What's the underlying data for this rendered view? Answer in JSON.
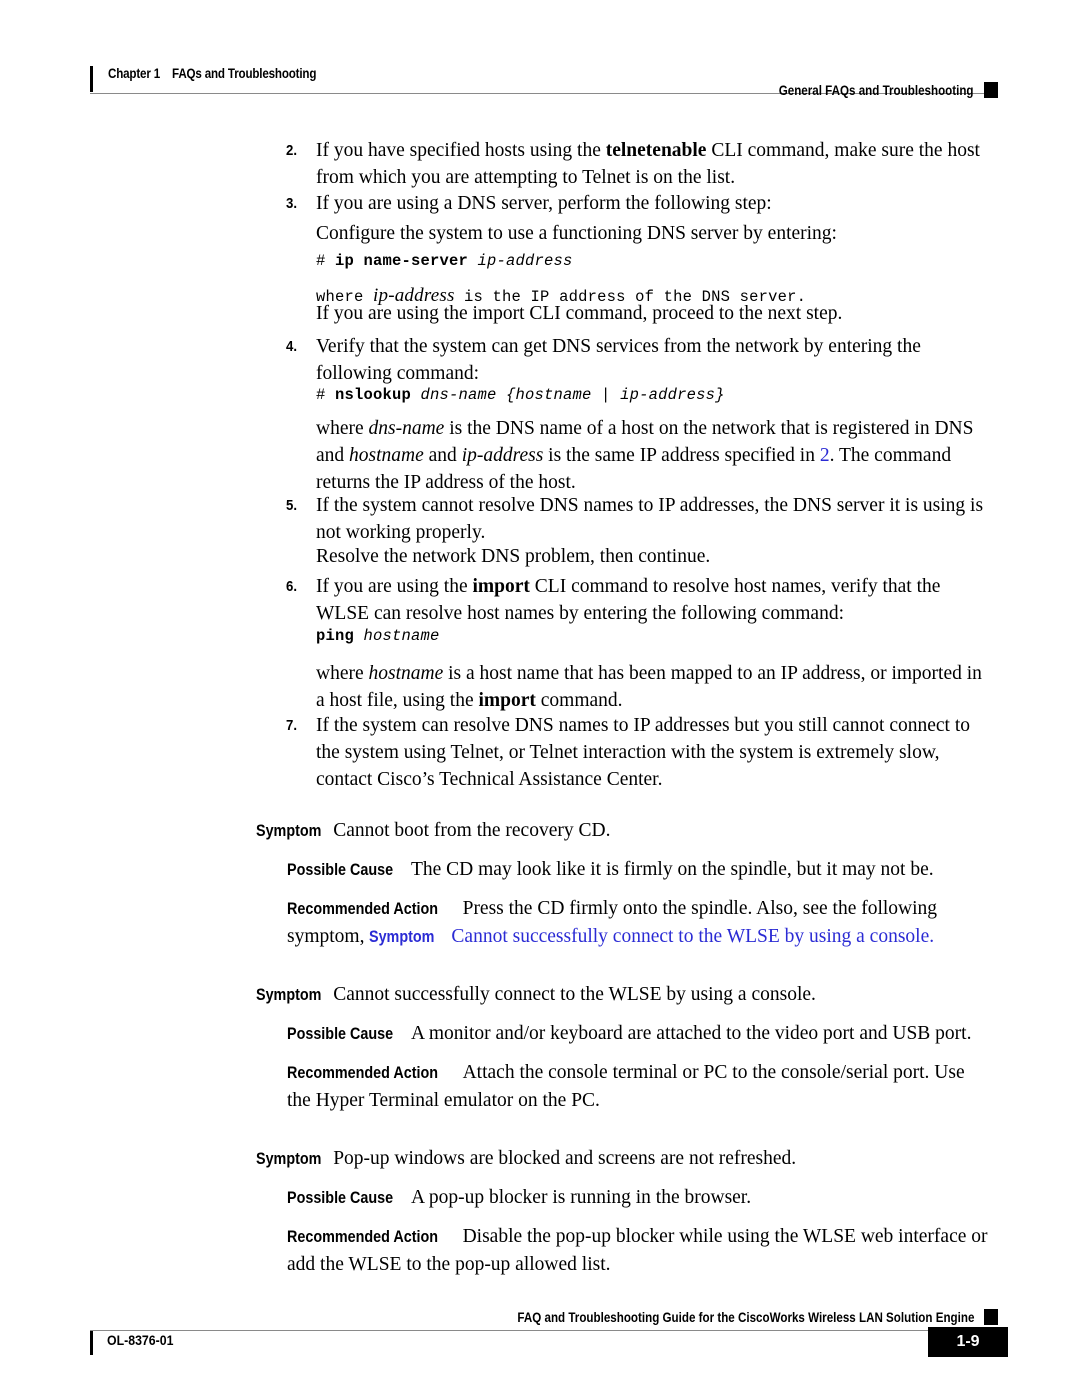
{
  "header": {
    "chapter_number": "Chapter 1",
    "chapter_title": "FAQs and Troubleshooting",
    "running_head": "General FAQs and Troubleshooting"
  },
  "steps": [
    {
      "number": "2.",
      "text_pre": "If you have specified hosts using the ",
      "bold": "telnetenable",
      "text_post": " CLI command, make sure the host from which you are attempting to Telnet is on the list."
    },
    {
      "number": "3.",
      "text": "If you are using a DNS server, perform the following step:"
    },
    {
      "number": "4.",
      "text": "Verify that the system can get DNS services from the network by entering the following command:"
    },
    {
      "number": "5.",
      "text": "If the system cannot resolve DNS names to IP addresses, the DNS server it is using is not working properly."
    },
    {
      "number": "6.",
      "text_pre": "If you are using the ",
      "bold": "import",
      "text_post": " CLI command to resolve host names, verify that the WLSE can resolve host names by entering the following command:"
    },
    {
      "number": "7.",
      "text": "If the system can resolve DNS names to IP addresses but you still cannot connect to the system using Telnet, or Telnet interaction with the system is extremely slow, contact Cisco’s Technical Assistance Center."
    }
  ],
  "paragraphs": {
    "configure_dns": "Configure the system to use a functioning DNS server by entering:",
    "import_next_step": "If you are using the import CLI command, proceed to the next step.",
    "resolve_continue": "Resolve the network DNS problem, then continue."
  },
  "code_blocks": {
    "ip_name_server": {
      "prompt": "# ",
      "command": "ip name-server",
      "arg": " ip-address"
    },
    "nslookup": {
      "prompt": "# ",
      "command": "nslookup",
      "arg": " dns-name {hostname | ip-address}"
    },
    "ping": {
      "prompt": "",
      "command": "ping",
      "arg": " hostname"
    }
  },
  "mono_note": {
    "where": "where ",
    "term": "ip-address",
    "rest": " is the IP address of the DNS server."
  },
  "where_clauses": {
    "dns_name": {
      "pre": "where ",
      "term1": "dns-name",
      "mid1": " is the DNS name of a host on the network that is registered in DNS and ",
      "term2": "hostname",
      "mid2": " and ",
      "term3": "ip-address",
      "mid3": " is the same IP address specified in ",
      "link": "2",
      "post": ". The command returns the IP address of the host."
    },
    "hostname": {
      "pre": "where ",
      "term": "hostname",
      "mid": " is a host name that has been mapped to an IP address, or imported in a host file, using the ",
      "bold": "import",
      "post": " command."
    }
  },
  "labels": {
    "symptom": "Symptom",
    "possible_cause": "Possible Cause",
    "recommended_action": "Recommended Action"
  },
  "symptom_blocks": [
    {
      "symptom": "Cannot boot from the recovery CD.",
      "possible_cause": "The CD may look like it is firmly on the spindle, but it may not be.",
      "recommended_action": "Press the CD firmly onto the spindle. Also, see the following symptom,",
      "link_label": "Symptom",
      "link_text": "Cannot successfully connect to the WLSE by using a console."
    },
    {
      "symptom": "Cannot successfully connect to the WLSE by using a console.",
      "possible_cause": "A monitor and/or keyboard are attached to the video port and USB port.",
      "recommended_action": "Attach the console terminal or PC to the console/serial port. Use the Hyper Terminal emulator on the PC."
    },
    {
      "symptom": "Pop-up windows are blocked and screens are not refreshed.",
      "possible_cause": "A pop-up blocker is running in the browser.",
      "recommended_action": "Disable the pop-up blocker while using the WLSE web interface or add the WLSE to the pop-up allowed list."
    }
  ],
  "footer": {
    "guide_title": "FAQ and Troubleshooting Guide for the CiscoWorks Wireless LAN Solution Engine",
    "doc_id": "OL-8376-01",
    "page_number": "1-9"
  },
  "colors": {
    "link": "#2b2bd4",
    "rule": "#8a8a8a",
    "text": "#000000"
  }
}
